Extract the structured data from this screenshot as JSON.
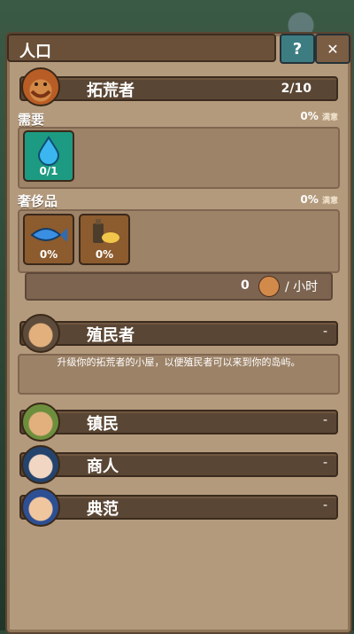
{
  "panel": {
    "title": "人口",
    "help_label": "?",
    "close_label": "✕"
  },
  "pioneer": {
    "name": "拓荒者",
    "count": "2/10",
    "needs": {
      "label": "需要",
      "satisfaction": "0%",
      "satisfaction_label": "满意",
      "items": [
        {
          "icon": "water-drop-icon",
          "value": "0/1"
        }
      ]
    },
    "luxury": {
      "label": "奢侈品",
      "satisfaction": "0%",
      "satisfaction_label": "满意",
      "items": [
        {
          "icon": "fish-icon",
          "value": "0%"
        },
        {
          "icon": "bottle-bread-icon",
          "value": "0%"
        }
      ]
    },
    "production": {
      "value": "0",
      "unit": "/ 小时",
      "icon": "worker-avatar-icon"
    }
  },
  "tiers": [
    {
      "name": "殖民者",
      "suffix": "-"
    },
    {
      "name": "镇民",
      "suffix": "-"
    },
    {
      "name": "商人",
      "suffix": "-"
    },
    {
      "name": "典范",
      "suffix": "-"
    }
  ],
  "colonist_info": "升级你的拓荒者的小屋，以便殖民者可以来到你的岛屿。",
  "colors": {
    "panel": "#b49a7c",
    "bar": "#5a4634",
    "teal": "#22917a",
    "brown_item": "#8c5b2e"
  }
}
